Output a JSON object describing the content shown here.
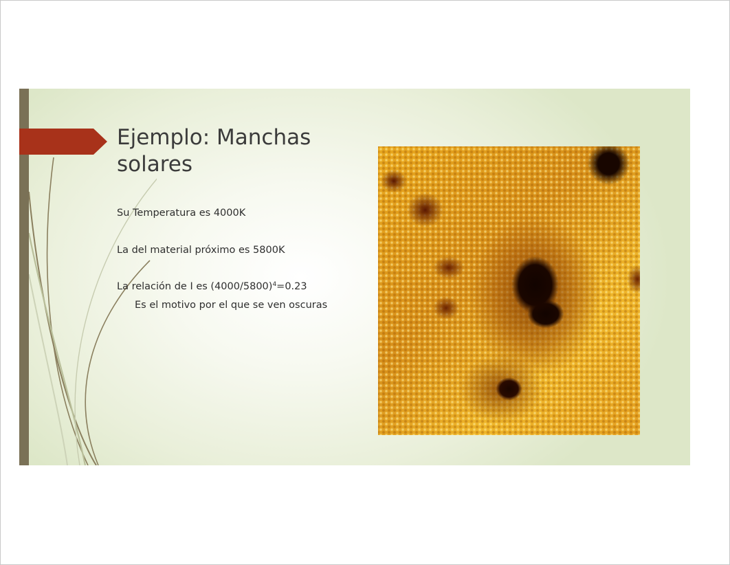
{
  "slide": {
    "title": "Ejemplo: Manchas solares",
    "lines": {
      "temperature": "Su Temperatura es 4000K",
      "nearby_material": "La del material próximo es 5800K",
      "ratio_prefix": "La relación de I es (4000/5800)",
      "ratio_exponent": "4",
      "ratio_suffix": "=0.23",
      "explanation": "Es el motivo por el que se ven oscuras"
    }
  },
  "colors": {
    "accent_arrow": "#a8321a",
    "left_bar": "#7a7156",
    "background": "#e9efd9"
  }
}
